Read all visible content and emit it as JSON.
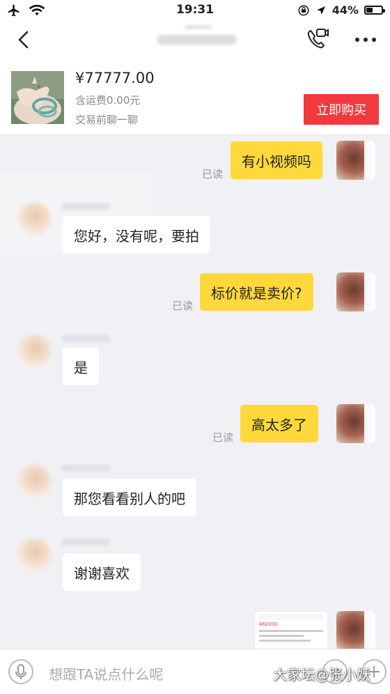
{
  "status_bar": {
    "time": "19:31",
    "battery_text": "44%",
    "battery_level": 0.44,
    "icons": [
      "airplane-icon",
      "wifi-icon",
      "rotation-lock-icon",
      "location-icon",
      "battery-icon"
    ]
  },
  "nav": {
    "icons": [
      "back-icon",
      "phone-video-icon",
      "more-icon"
    ]
  },
  "product": {
    "price": "¥77777.00",
    "shipping": "含运费0.00元",
    "chat_first": "交易前聊一聊",
    "buy_label": "立即购买"
  },
  "messages": [
    {
      "side": "out",
      "text": "有小视频吗",
      "read": "已读"
    },
    {
      "side": "in",
      "text": "您好，没有呢，要拍"
    },
    {
      "side": "out",
      "text": "标价就是卖价?",
      "read": "已读"
    },
    {
      "side": "in",
      "text": "是"
    },
    {
      "side": "out",
      "text": "高太多了",
      "read": "已读"
    },
    {
      "side": "in",
      "text": "那您看看别人的吧"
    },
    {
      "side": "in",
      "text": "谢谢喜欢"
    },
    {
      "side": "out",
      "type": "image",
      "snippet": "¥62000"
    }
  ],
  "input": {
    "placeholder": "想跟TA说点什么呢"
  },
  "watermark": "大家坛@张小妖",
  "colors": {
    "accent_buy": "#f2393e",
    "bubble_out": "#ffd93b",
    "bubble_in": "#ffffff",
    "background": "#f0f0f5"
  }
}
